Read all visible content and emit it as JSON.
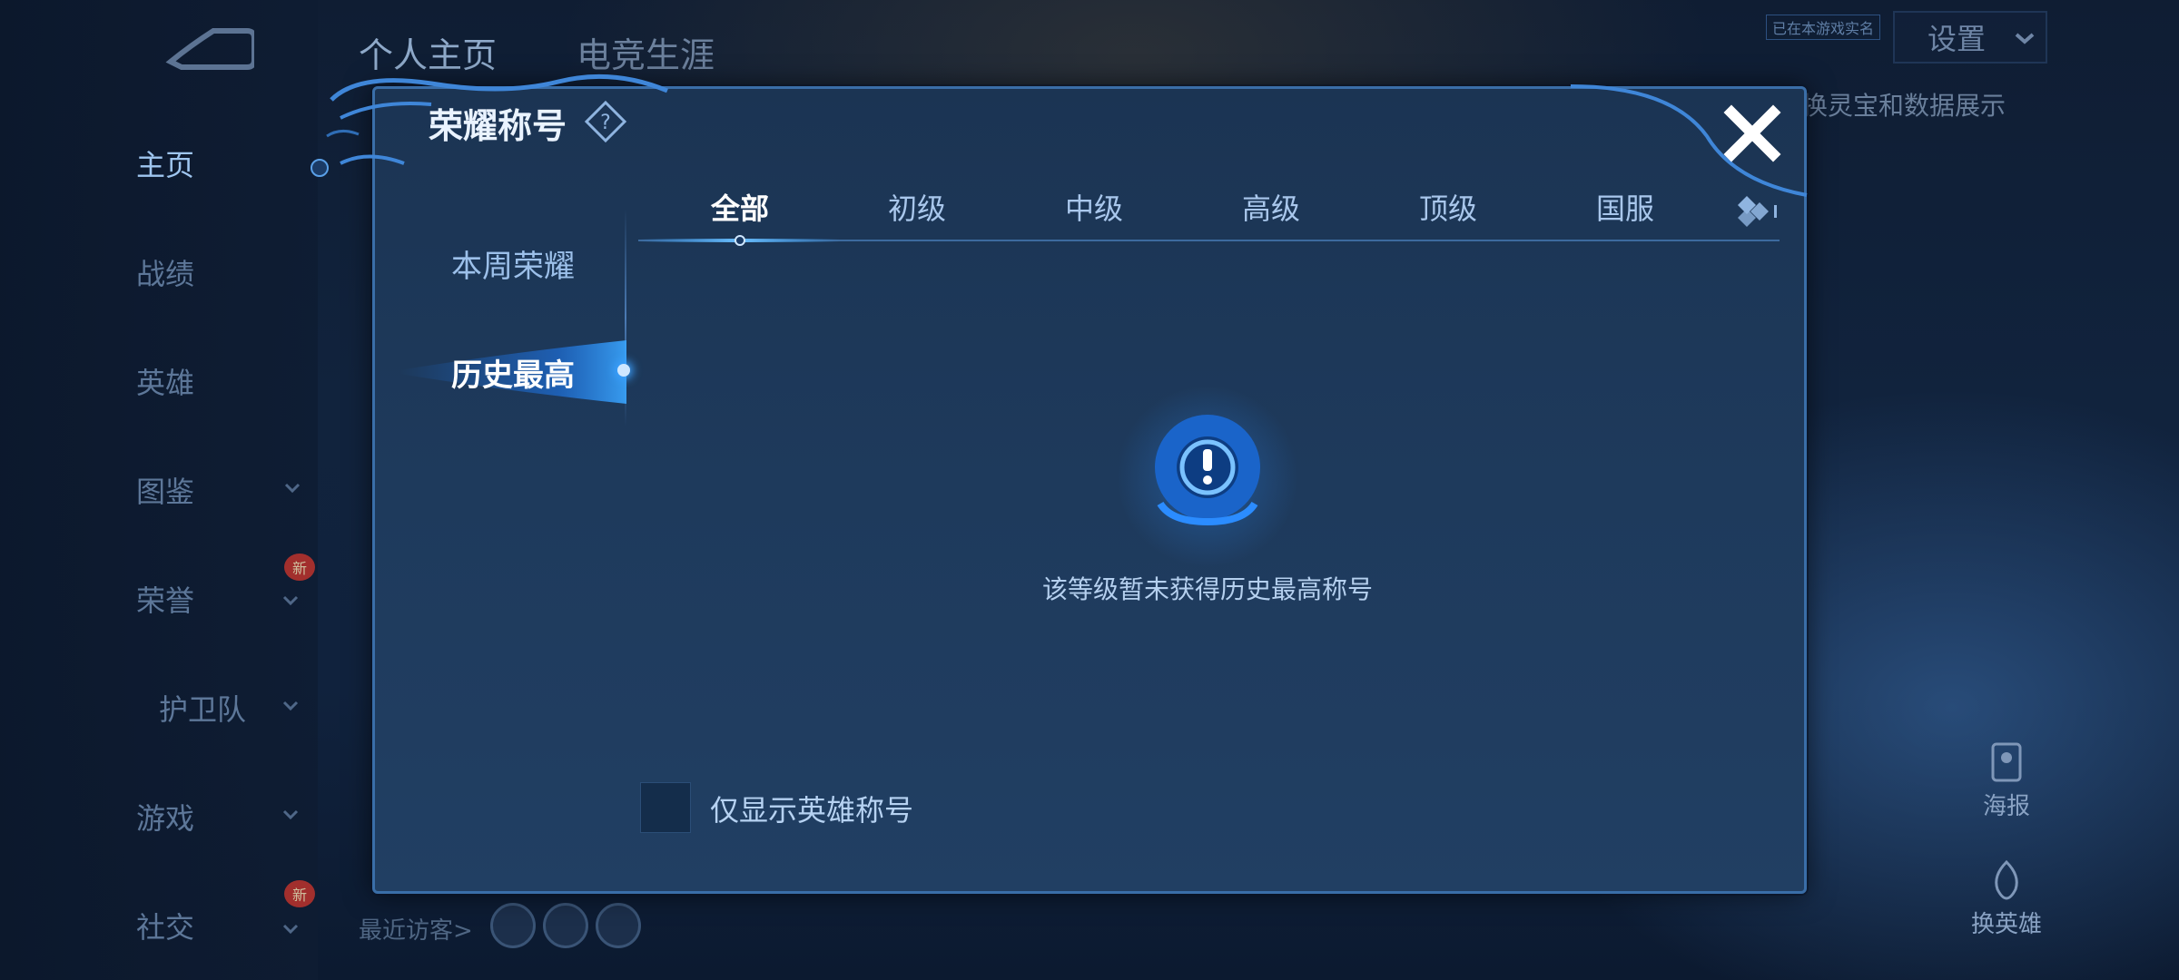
{
  "left_nav": {
    "items": [
      {
        "label": "主页",
        "has_chevron": false,
        "active": true
      },
      {
        "label": "战绩",
        "has_chevron": false,
        "active": false
      },
      {
        "label": "英雄",
        "has_chevron": false,
        "active": false
      },
      {
        "label": "图鉴",
        "has_chevron": true,
        "active": false
      },
      {
        "label": "荣誉",
        "has_chevron": true,
        "active": false,
        "badge": "新"
      },
      {
        "label": "护卫队",
        "has_chevron": true,
        "active": false
      },
      {
        "label": "游戏",
        "has_chevron": true,
        "active": false
      },
      {
        "label": "社交",
        "has_chevron": true,
        "active": false,
        "badge": "新"
      }
    ]
  },
  "header": {
    "tabs": [
      {
        "label": "个人主页",
        "active": true
      },
      {
        "label": "电竞生涯",
        "active": false
      }
    ],
    "small_note": "已在本游戏实名",
    "settings_label": "设置",
    "setting_hint": "换灵宝和数据展示"
  },
  "visitors": {
    "label": "最近访客>"
  },
  "right_buttons": [
    {
      "label": "海报"
    },
    {
      "label": "换英雄"
    }
  ],
  "modal": {
    "title": "荣耀称号",
    "side_items": [
      {
        "label": "本周荣耀",
        "active": false
      },
      {
        "label": "历史最高",
        "active": true
      }
    ],
    "tabs": [
      {
        "label": "全部",
        "active": true
      },
      {
        "label": "初级",
        "active": false
      },
      {
        "label": "中级",
        "active": false
      },
      {
        "label": "高级",
        "active": false
      },
      {
        "label": "顶级",
        "active": false
      },
      {
        "label": "国服",
        "active": false
      }
    ],
    "empty_message": "该等级暂未获得历史最高称号",
    "checkbox": {
      "label": "仅显示英雄称号",
      "checked": false
    }
  },
  "colors": {
    "accent": "#3ba0ff",
    "modal_border": "#3a6ea8",
    "background": "#11233d"
  }
}
